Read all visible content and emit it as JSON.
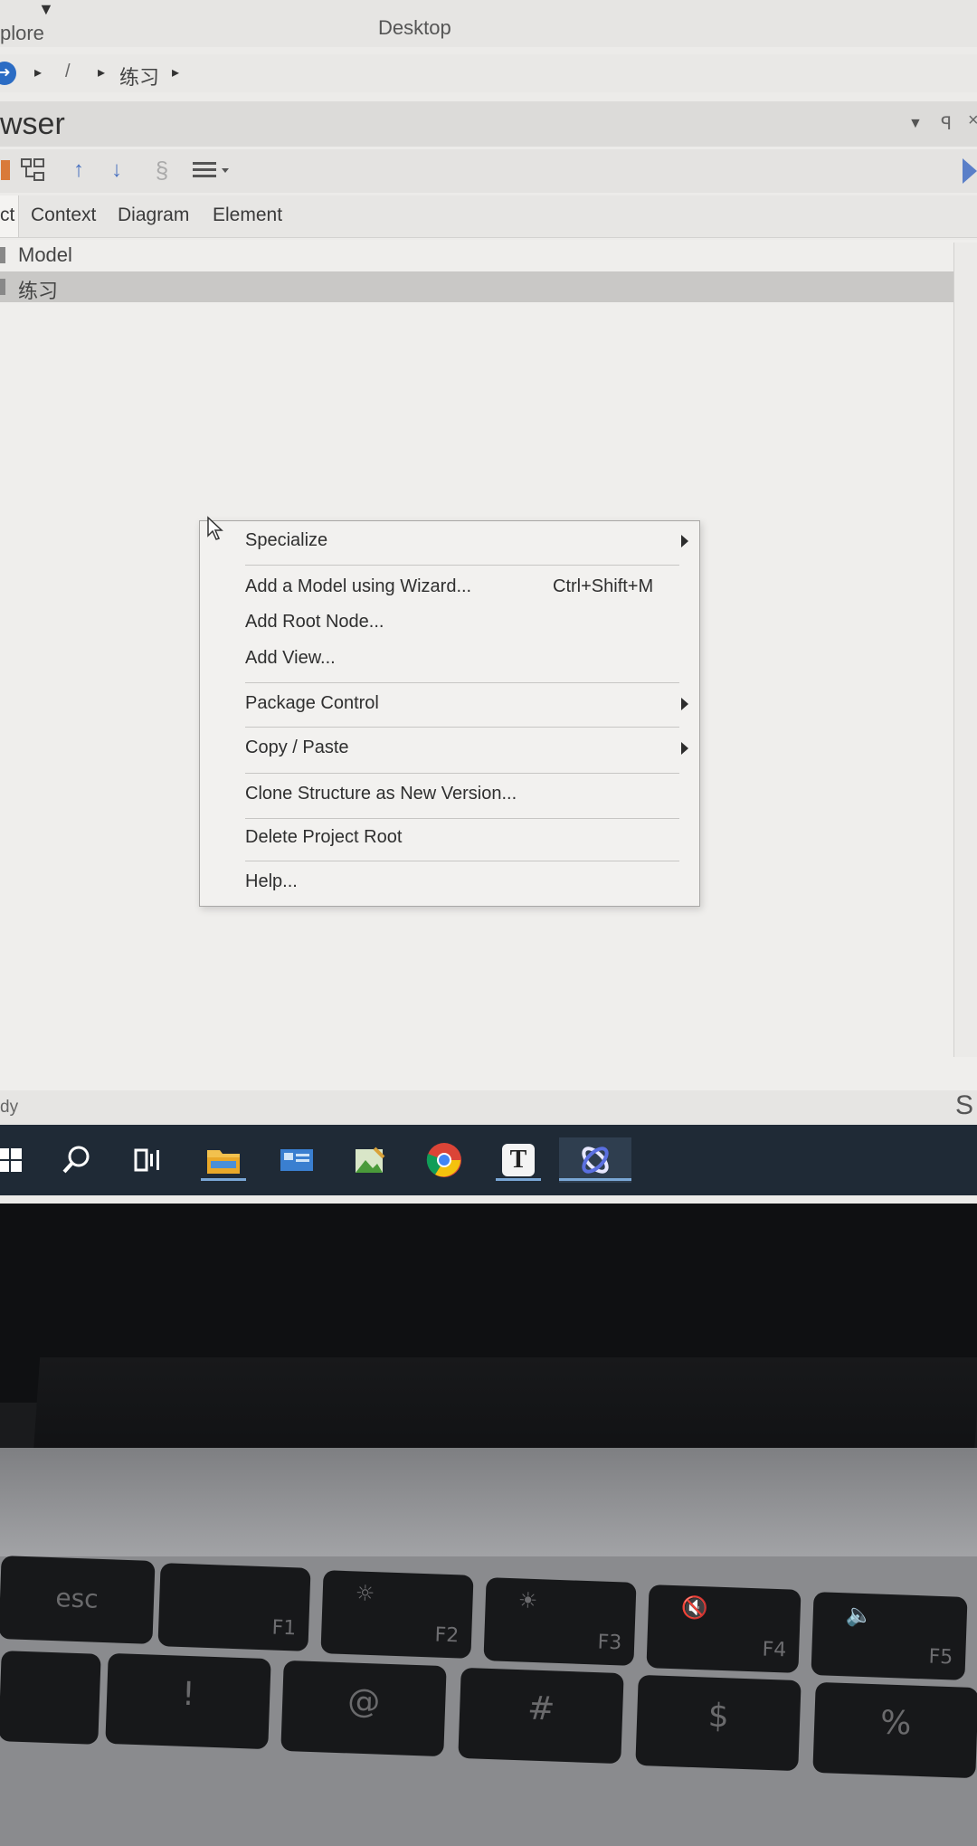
{
  "window": {
    "explore_label": "plore",
    "desktop_label": "Desktop",
    "breadcrumb": {
      "slash": "/",
      "folder": "练习"
    },
    "title": "wser",
    "tabs": [
      "ct",
      "Context",
      "Diagram",
      "Element"
    ]
  },
  "tree": {
    "items": [
      {
        "label": "Model"
      },
      {
        "label": "练习",
        "selected": true
      }
    ]
  },
  "context_menu": {
    "specialize": "Specialize",
    "add_model_wizard": "Add a Model using Wizard...",
    "add_model_shortcut": "Ctrl+Shift+M",
    "add_root_node": "Add Root Node...",
    "add_view": "Add View...",
    "package_control": "Package Control",
    "copy_paste": "Copy / Paste",
    "clone_structure": "Clone Structure as New Version...",
    "delete_project_root": "Delete Project Root",
    "help": "Help..."
  },
  "status": {
    "left": "dy",
    "right": "S"
  },
  "taskbar": {
    "icons": [
      "windows-start-icon",
      "search-icon",
      "task-view-icon",
      "file-explorer-icon",
      "control-panel-icon",
      "photos-icon",
      "chrome-icon",
      "typora-icon",
      "enterprise-architect-icon"
    ]
  },
  "keyboard": {
    "keys": [
      {
        "main": "esc"
      },
      {
        "fn": "F1"
      },
      {
        "fn": "F2",
        "sym": "☼"
      },
      {
        "fn": "F3",
        "sym": "☀"
      },
      {
        "fn": "F4",
        "sym": "🔇"
      },
      {
        "fn": "F5",
        "sym": "🔈"
      }
    ],
    "row2": [
      "!",
      "@",
      "#",
      "$",
      "%"
    ]
  },
  "colors": {
    "accent": "#2b6cc4",
    "taskbar": "#1f2a36",
    "menu_bg": "#f2f1ef"
  }
}
